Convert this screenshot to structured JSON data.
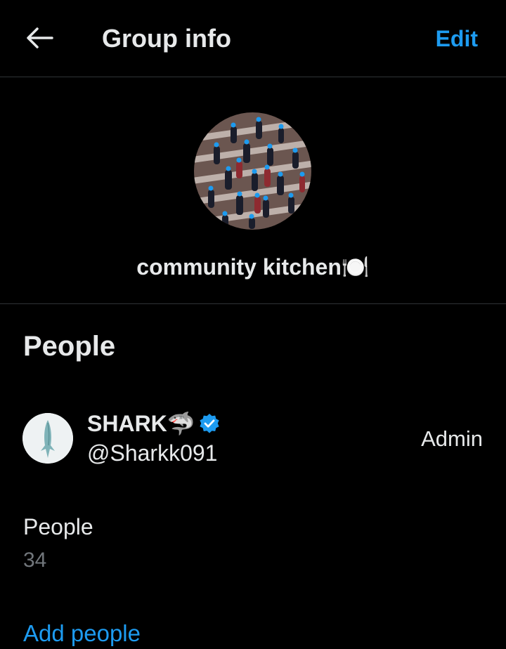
{
  "header": {
    "back_icon": "arrow-left-icon",
    "title": "Group info",
    "edit_label": "Edit"
  },
  "group": {
    "avatar": "crowd-photo",
    "name": "community kitchen🍽️"
  },
  "people_section": {
    "heading": "People",
    "members": [
      {
        "name": "SHARK🦈",
        "verified": true,
        "verified_icon": "verified-badge-icon",
        "handle": "@Sharkk091",
        "role": "Admin"
      }
    ],
    "count_label": "People",
    "count_value": "34",
    "add_label": "Add people"
  },
  "colors": {
    "background": "#000000",
    "text": "#e7e9ea",
    "muted": "#71767b",
    "accent": "#1d9bf0",
    "divider": "#2f3336"
  }
}
